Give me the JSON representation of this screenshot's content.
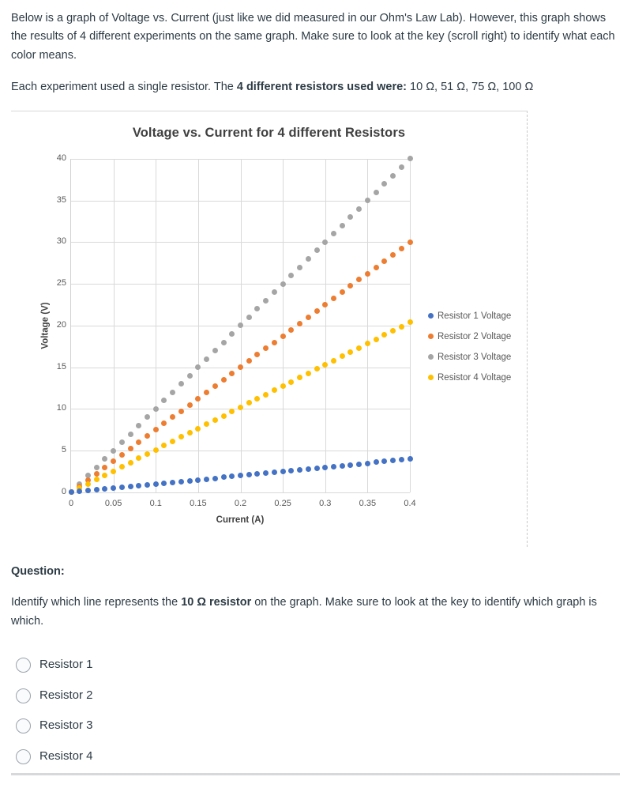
{
  "intro": {
    "paragraph1": "Below is a graph of Voltage vs. Current (just like we did measured in our Ohm's Law Lab).  However, this graph shows the results of 4 different experiments on the same graph.  Make sure to look at the key (scroll right) to identify what each color means.",
    "paragraph2_before": "Each experiment used a single resistor.  The ",
    "paragraph2_bold": "4 different resistors used were:",
    "paragraph2_after": "  10 Ω, 51 Ω, 75 Ω, 100 Ω"
  },
  "chart_data": {
    "type": "scatter",
    "title": "Voltage vs. Current for 4 different Resistors",
    "xlabel": "Current (A)",
    "ylabel": "Voltage (V)",
    "xlim": [
      0,
      0.4
    ],
    "ylim": [
      0,
      40
    ],
    "xticks": [
      "0",
      "0.05",
      "0.1",
      "0.15",
      "0.2",
      "0.25",
      "0.3",
      "0.35",
      "0.4"
    ],
    "xtick_values": [
      0,
      0.05,
      0.1,
      0.15,
      0.2,
      0.25,
      0.3,
      0.35,
      0.4
    ],
    "yticks": [
      "0",
      "5",
      "10",
      "15",
      "20",
      "25",
      "30",
      "35",
      "40"
    ],
    "ytick_values": [
      0,
      5,
      10,
      15,
      20,
      25,
      30,
      35,
      40
    ],
    "grid": true,
    "legend_position": "right",
    "x": [
      0,
      0.01,
      0.02,
      0.03,
      0.04,
      0.05,
      0.06,
      0.07,
      0.08,
      0.09,
      0.1,
      0.11,
      0.12,
      0.13,
      0.14,
      0.15,
      0.16,
      0.17,
      0.18,
      0.19,
      0.2,
      0.21,
      0.22,
      0.23,
      0.24,
      0.25,
      0.26,
      0.27,
      0.28,
      0.29,
      0.3,
      0.31,
      0.32,
      0.33,
      0.34,
      0.35,
      0.36,
      0.37,
      0.38,
      0.39,
      0.4
    ],
    "series": [
      {
        "name": "Resistor 1 Voltage",
        "color": "#4472C4",
        "resistance_ohms": 10,
        "values": [
          0,
          0.1,
          0.2,
          0.3,
          0.4,
          0.5,
          0.6,
          0.7,
          0.8,
          0.9,
          1.0,
          1.1,
          1.2,
          1.3,
          1.4,
          1.5,
          1.6,
          1.7,
          1.8,
          1.9,
          2.0,
          2.1,
          2.2,
          2.3,
          2.4,
          2.5,
          2.6,
          2.7,
          2.8,
          2.9,
          3.0,
          3.1,
          3.2,
          3.3,
          3.4,
          3.5,
          3.6,
          3.7,
          3.8,
          3.9,
          4.0
        ]
      },
      {
        "name": "Resistor 2 Voltage",
        "color": "#ED7D31",
        "resistance_ohms": 75,
        "values": [
          0,
          0.75,
          1.5,
          2.25,
          3.0,
          3.75,
          4.5,
          5.25,
          6.0,
          6.75,
          7.5,
          8.25,
          9.0,
          9.75,
          10.5,
          11.25,
          12.0,
          12.75,
          13.5,
          14.25,
          15.0,
          15.75,
          16.5,
          17.25,
          18.0,
          18.75,
          19.5,
          20.25,
          21.0,
          21.75,
          22.5,
          23.25,
          24.0,
          24.75,
          25.5,
          26.25,
          27.0,
          27.75,
          28.5,
          29.25,
          30.0
        ]
      },
      {
        "name": "Resistor 3 Voltage",
        "color": "#A5A5A5",
        "resistance_ohms": 100,
        "values": [
          0,
          1,
          2,
          3,
          4,
          5,
          6,
          7,
          8,
          9,
          10,
          11,
          12,
          13,
          14,
          15,
          16,
          17,
          18,
          19,
          20,
          21,
          22,
          23,
          24,
          25,
          26,
          27,
          28,
          29,
          30,
          31,
          32,
          33,
          34,
          35,
          36,
          37,
          38,
          39,
          40
        ]
      },
      {
        "name": "Resistor 4 Voltage",
        "color": "#FFC000",
        "resistance_ohms": 51,
        "values": [
          0,
          0.51,
          1.02,
          1.53,
          2.04,
          2.55,
          3.06,
          3.57,
          4.08,
          4.59,
          5.1,
          5.61,
          6.12,
          6.63,
          7.14,
          7.65,
          8.16,
          8.67,
          9.18,
          9.69,
          10.2,
          10.71,
          11.22,
          11.73,
          12.24,
          12.75,
          13.26,
          13.77,
          14.28,
          14.79,
          15.3,
          15.81,
          16.32,
          16.83,
          17.34,
          17.85,
          18.36,
          18.87,
          19.38,
          19.89,
          20.4
        ]
      }
    ]
  },
  "question": {
    "heading": "Question:",
    "text_before": "Identify which line represents the ",
    "text_bold": "10 Ω resistor",
    "text_after": " on the graph.  Make sure to look at the key to identify which graph is which.",
    "options": [
      {
        "label": "Resistor 1",
        "selected": false
      },
      {
        "label": "Resistor 2",
        "selected": false
      },
      {
        "label": "Resistor 3",
        "selected": false
      },
      {
        "label": "Resistor 4",
        "selected": false
      }
    ]
  }
}
